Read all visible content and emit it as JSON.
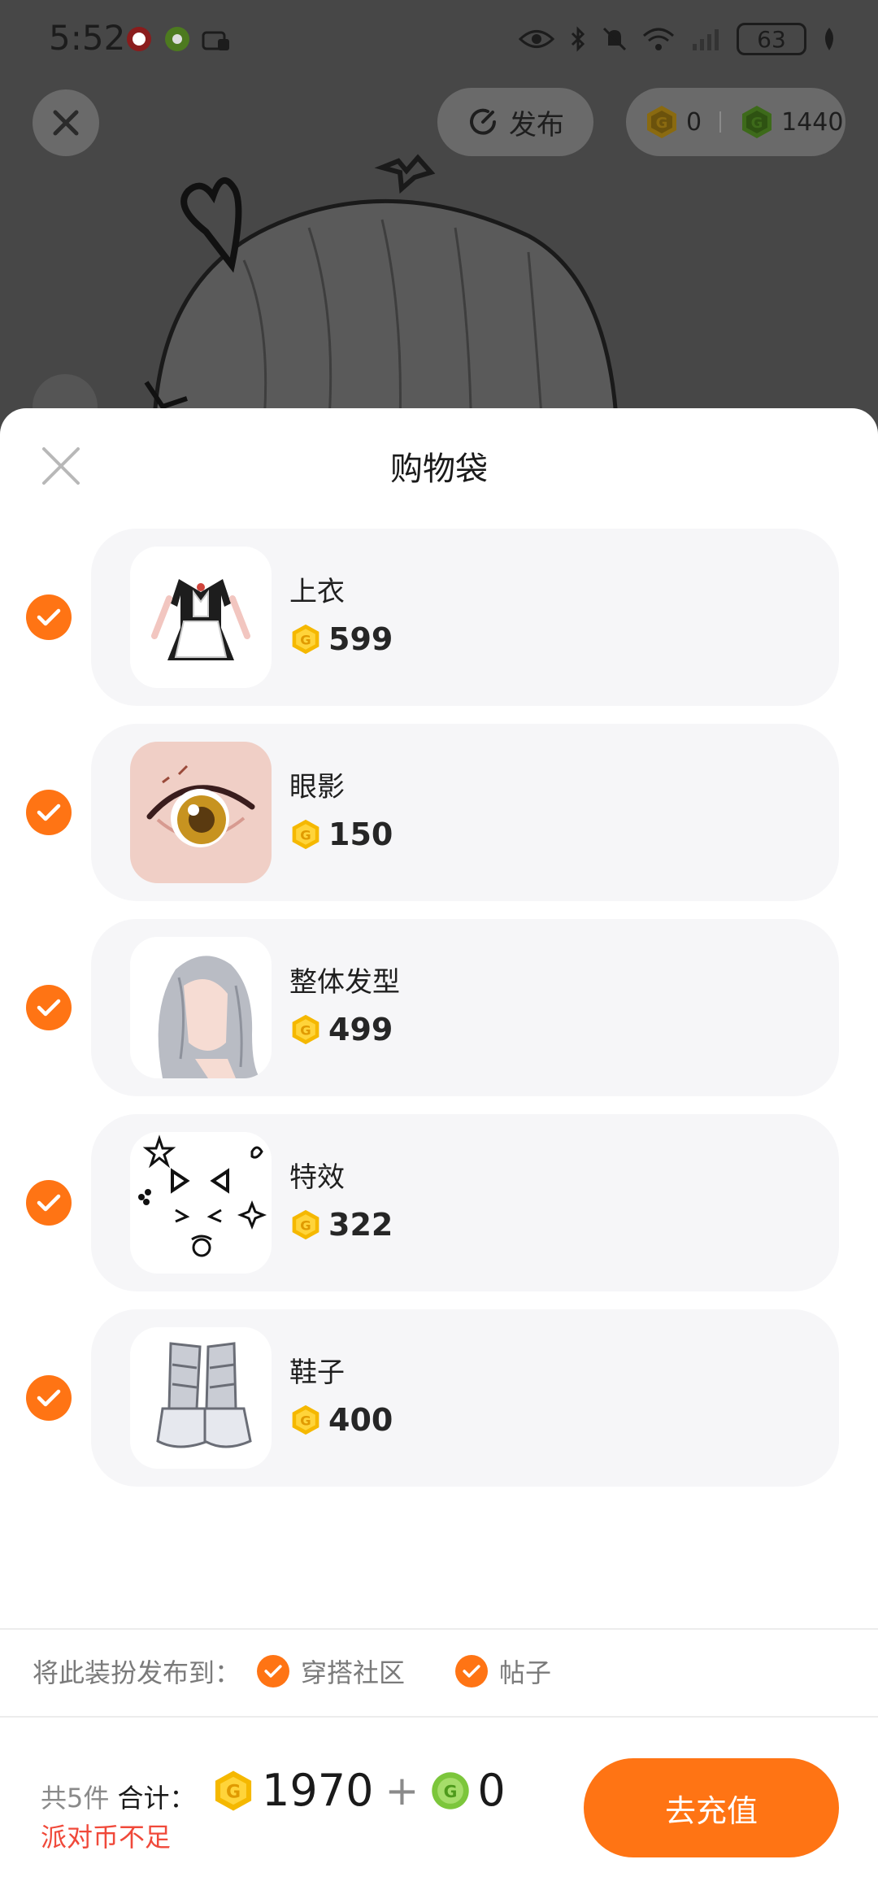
{
  "status_bar": {
    "time": "5:52",
    "battery": "63"
  },
  "top_bar": {
    "publish_label": "发布",
    "gold_balance": "0",
    "green_balance": "1440"
  },
  "sheet": {
    "title": "购物袋",
    "items": [
      {
        "name": "上衣",
        "price": "599",
        "thumb": "maid-outfit-icon"
      },
      {
        "name": "眼影",
        "price": "150",
        "thumb": "eye-makeup-icon"
      },
      {
        "name": "整体发型",
        "price": "499",
        "thumb": "hairstyle-icon"
      },
      {
        "name": "特效",
        "price": "322",
        "thumb": "face-effect-icon"
      },
      {
        "name": "鞋子",
        "price": "400",
        "thumb": "shoes-icon"
      }
    ],
    "publish_to_label": "将此装扮发布到：",
    "publish_options": [
      "穿搭社区",
      "帖子"
    ]
  },
  "footer": {
    "count_text": "共5件",
    "total_label": "合计：",
    "gold_total": "1970",
    "plus": "+",
    "green_total": "0",
    "warning": "派对币不足",
    "recharge_label": "去充值"
  },
  "colors": {
    "accent": "#ff7414",
    "gold_coin": "#f5b800",
    "green_coin": "#7cc63b",
    "warning": "#f0493a",
    "card_bg": "#f6f6f8"
  }
}
